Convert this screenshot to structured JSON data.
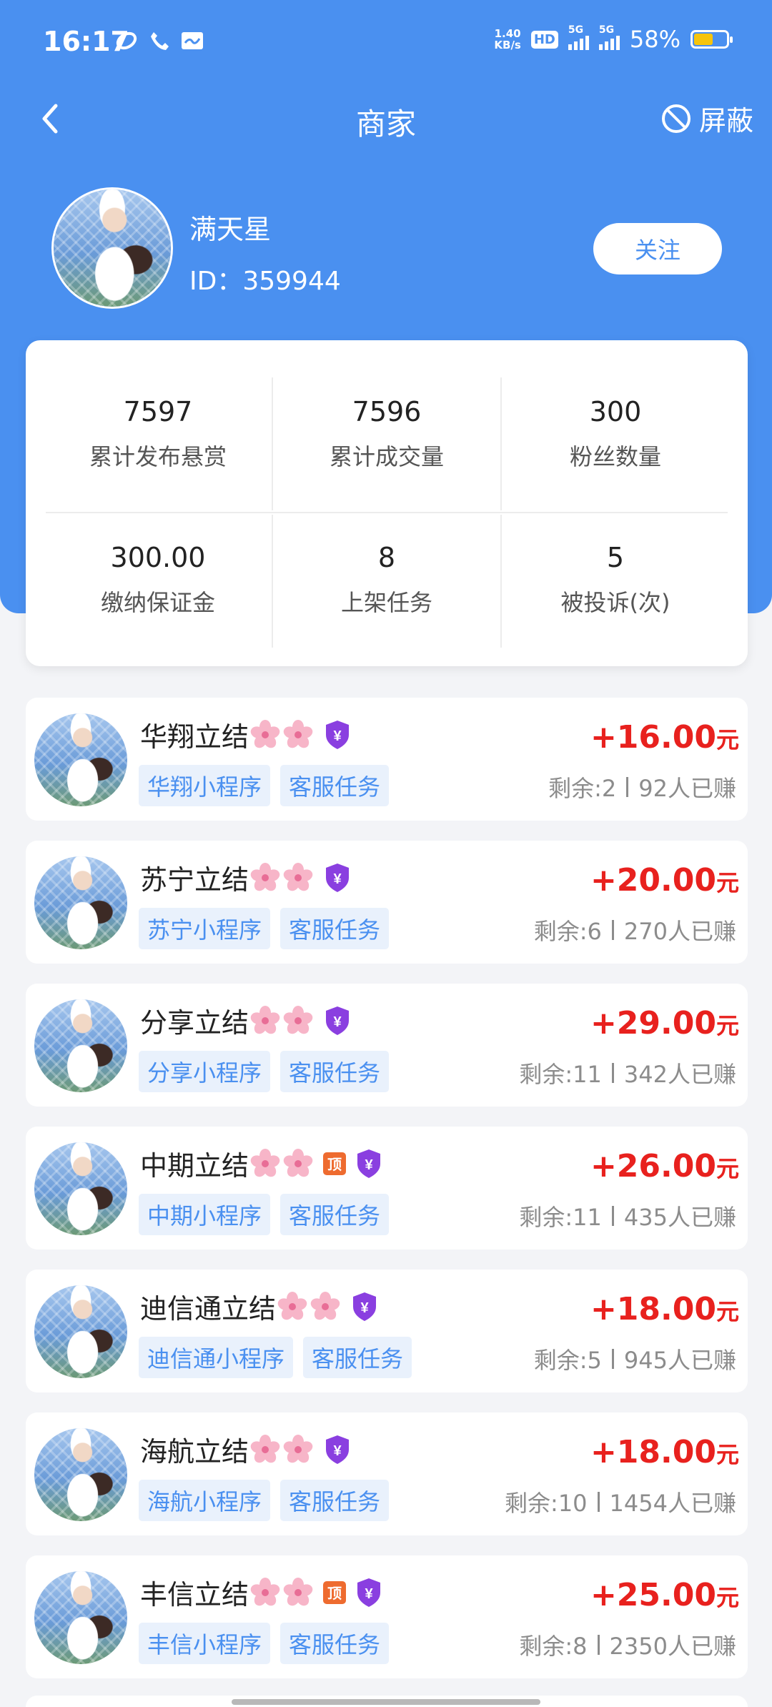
{
  "status_bar": {
    "time": "16:17",
    "speed_top": "1.40",
    "speed_unit": "KB/s",
    "hd": "HD",
    "net1": "5G",
    "net2": "5G",
    "battery": "58%",
    "battery_level": 0.58,
    "battery_color": "#f6c40c"
  },
  "nav": {
    "title": "商家",
    "block_label": "屏蔽",
    "back_icon": "chevron-left-icon",
    "block_icon": "block-icon"
  },
  "profile": {
    "name": "满天星",
    "id_text": "ID：359944",
    "follow_label": "关注"
  },
  "stats": [
    {
      "value": "7597",
      "label": "累计发布悬赏"
    },
    {
      "value": "7596",
      "label": "累计成交量"
    },
    {
      "value": "300",
      "label": "粉丝数量"
    },
    {
      "value": "300.00",
      "label": "缴纳保证金"
    },
    {
      "value": "8",
      "label": "上架任务"
    },
    {
      "value": "5",
      "label": "被投诉(次)"
    }
  ],
  "tasks": [
    {
      "title": "华翔立结",
      "top_badge": false,
      "tag1": "华翔小程序",
      "tag2": "客服任务",
      "price": "+16.00",
      "unit": "元",
      "remain": "剩余:2",
      "earned": "92人已赚"
    },
    {
      "title": "苏宁立结",
      "top_badge": false,
      "tag1": "苏宁小程序",
      "tag2": "客服任务",
      "price": "+20.00",
      "unit": "元",
      "remain": "剩余:6",
      "earned": "270人已赚"
    },
    {
      "title": "分享立结",
      "top_badge": false,
      "tag1": "分享小程序",
      "tag2": "客服任务",
      "price": "+29.00",
      "unit": "元",
      "remain": "剩余:11",
      "earned": "342人已赚"
    },
    {
      "title": "中期立结",
      "top_badge": true,
      "badge_text": "顶",
      "tag1": "中期小程序",
      "tag2": "客服任务",
      "price": "+26.00",
      "unit": "元",
      "remain": "剩余:11",
      "earned": "435人已赚"
    },
    {
      "title": "迪信通立结",
      "top_badge": false,
      "tag1": "迪信通小程序",
      "tag2": "客服任务",
      "price": "+18.00",
      "unit": "元",
      "remain": "剩余:5",
      "earned": "945人已赚"
    },
    {
      "title": "海航立结",
      "top_badge": false,
      "tag1": "海航小程序",
      "tag2": "客服任务",
      "price": "+18.00",
      "unit": "元",
      "remain": "剩余:10",
      "earned": "1454人已赚"
    },
    {
      "title": "丰信立结",
      "top_badge": true,
      "badge_text": "顶",
      "tag1": "丰信小程序",
      "tag2": "客服任务",
      "price": "+25.00",
      "unit": "元",
      "remain": "剩余:8",
      "earned": "2350人已赚"
    }
  ],
  "colors": {
    "primary": "#4a90f0",
    "price": "#e8211e",
    "shield": "#8a3fe0",
    "top_badge": "#ee6b2f"
  }
}
